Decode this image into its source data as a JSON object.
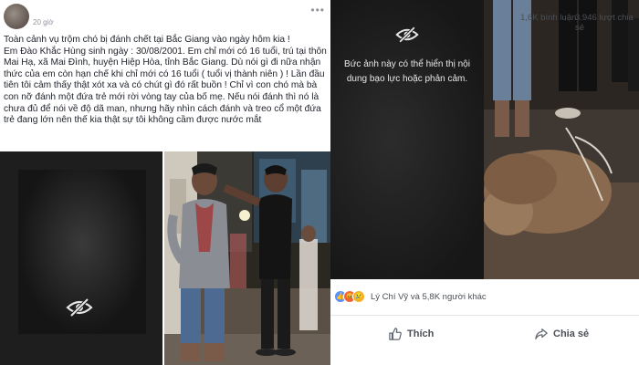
{
  "post": {
    "time": "20 giờ",
    "more_label": "•••",
    "paragraphs": [
      "Toàn cảnh vụ trộm chó bị đánh chết tại Bắc Giang vào ngày hôm kia !",
      "Em Đào Khắc Hùng sinh ngày : 30/08/2001. Em chỉ mới có 16 tuổi, trú tại thôn Mai Hạ, xã Mai Đình, huyện Hiệp Hòa, tỉnh Bắc Giang. Dù nói gì đi nữa nhận thức của em còn hạn chế khi chỉ mới có 16 tuổi ( tuổi vị thành niên ) ! Lần đầu tiên tôi cảm thấy thật xót xa và có chút gì đó rất buồn ! Chỉ vì con chó mà bà con nỡ đánh một đứa trẻ mới rời vòng tay của bố mẹ. Nếu nói đánh thì nó là chưa đủ để nói về độ dã man, nhưng hãy nhìn cách đánh và treo cổ một đứa trẻ đang lớn nên thế kia thật sự tôi không cầm được nước mắt"
    ]
  },
  "sensitive": {
    "message": "Bức ảnh này có thể hiển thị nội dung bạo lực hoặc phản cảm.",
    "icon": "eye-slash-icon"
  },
  "reactions": {
    "names": "Lý Chí Vỹ và 5,8K người khác",
    "comments": "1,6K bình luận",
    "shares": "3.946 lượt chia sẻ",
    "colors": {
      "like": "#5890ff",
      "angry": "#f0643c",
      "sad": "#f7b125"
    }
  },
  "actions": {
    "like_label": "Thích",
    "share_label": "Chia sẻ"
  }
}
